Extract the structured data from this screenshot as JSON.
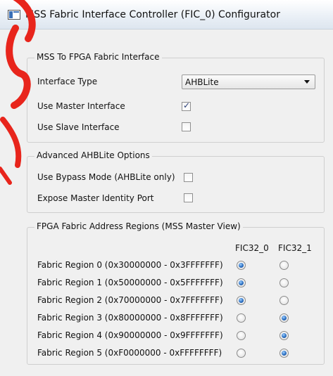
{
  "window": {
    "title": "MSS Fabric Interface Controller (FIC_0) Configurator"
  },
  "mss_to_fpga": {
    "group_label": "MSS To FPGA Fabric Interface",
    "interface_type_label": "Interface Type",
    "interface_type_value": "AHBLite",
    "use_master_label": "Use Master Interface",
    "use_master_checked": true,
    "use_slave_label": "Use Slave Interface",
    "use_slave_checked": false
  },
  "advanced": {
    "group_label": "Advanced AHBLite Options",
    "bypass_label": "Use Bypass Mode (AHBLite only)",
    "bypass_checked": false,
    "expose_label": "Expose Master Identity Port",
    "expose_checked": false
  },
  "regions": {
    "group_label": "FPGA Fabric Address Regions (MSS Master View)",
    "columns": [
      "FIC32_0",
      "FIC32_1"
    ],
    "rows": [
      {
        "label": "Fabric Region 0 (0x30000000 - 0x3FFFFFFF)",
        "selected": "FIC32_0"
      },
      {
        "label": "Fabric Region 1 (0x50000000 - 0x5FFFFFFF)",
        "selected": "FIC32_0"
      },
      {
        "label": "Fabric Region 2 (0x70000000 - 0x7FFFFFFF)",
        "selected": "FIC32_0"
      },
      {
        "label": "Fabric Region 3 (0x80000000 - 0x8FFFFFFF)",
        "selected": "FIC32_1"
      },
      {
        "label": "Fabric Region 4 (0x90000000 - 0x9FFFFFFF)",
        "selected": "FIC32_1"
      },
      {
        "label": "Fabric Region 5 (0xF0000000 - 0xFFFFFFFF)",
        "selected": "FIC32_1"
      }
    ]
  },
  "colors": {
    "watermark": "#e8251c"
  }
}
